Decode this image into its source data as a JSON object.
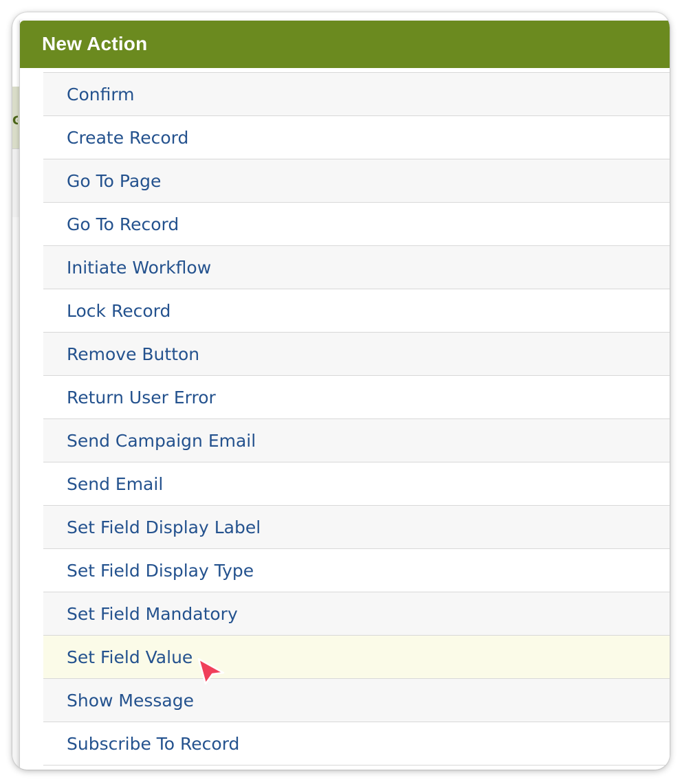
{
  "dialog": {
    "title": "New Action"
  },
  "actions": [
    {
      "label": "Confirm"
    },
    {
      "label": "Create Record"
    },
    {
      "label": "Go To Page"
    },
    {
      "label": "Go To Record"
    },
    {
      "label": "Initiate Workflow"
    },
    {
      "label": "Lock Record"
    },
    {
      "label": "Remove Button"
    },
    {
      "label": "Return User Error"
    },
    {
      "label": "Send Campaign Email"
    },
    {
      "label": "Send Email"
    },
    {
      "label": "Set Field Display Label"
    },
    {
      "label": "Set Field Display Type"
    },
    {
      "label": "Set Field Mandatory"
    },
    {
      "label": "Set Field Value"
    },
    {
      "label": "Show Message"
    },
    {
      "label": "Subscribe To Record"
    }
  ],
  "hovered_action": "Set Field Value",
  "colors": {
    "header": "#6b8a1f",
    "link": "#24528e",
    "hover_row": "#fbfbe8",
    "cursor": "#f0405a"
  },
  "icons": {
    "pointer": "mouse-pointer-icon"
  }
}
